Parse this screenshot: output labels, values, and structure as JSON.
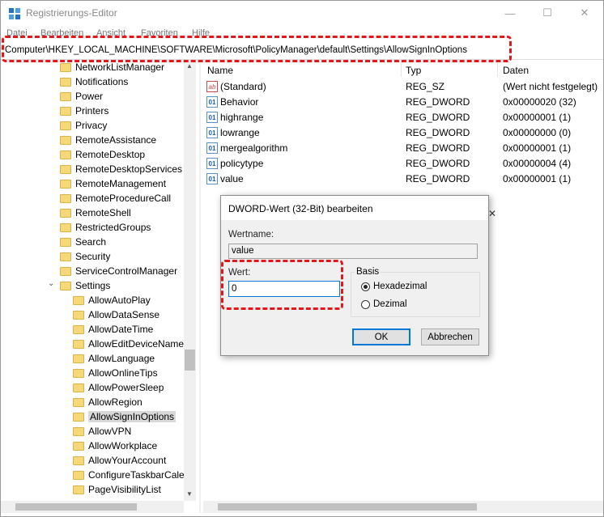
{
  "window": {
    "title": "Registrierungs-Editor"
  },
  "menu": [
    "Datei",
    "Bearbeiten",
    "Ansicht",
    "Favoriten",
    "Hilfe"
  ],
  "address": "Computer\\HKEY_LOCAL_MACHINE\\SOFTWARE\\Microsoft\\PolicyManager\\default\\Settings\\AllowSignInOptions",
  "tree": {
    "items": [
      {
        "label": "NetworkListManager",
        "level": 1
      },
      {
        "label": "Notifications",
        "level": 1
      },
      {
        "label": "Power",
        "level": 1
      },
      {
        "label": "Printers",
        "level": 1
      },
      {
        "label": "Privacy",
        "level": 1
      },
      {
        "label": "RemoteAssistance",
        "level": 1
      },
      {
        "label": "RemoteDesktop",
        "level": 1
      },
      {
        "label": "RemoteDesktopServices",
        "level": 1
      },
      {
        "label": "RemoteManagement",
        "level": 1
      },
      {
        "label": "RemoteProcedureCall",
        "level": 1
      },
      {
        "label": "RemoteShell",
        "level": 1
      },
      {
        "label": "RestrictedGroups",
        "level": 1
      },
      {
        "label": "Search",
        "level": 1
      },
      {
        "label": "Security",
        "level": 1
      },
      {
        "label": "ServiceControlManager",
        "level": 1
      },
      {
        "label": "Settings",
        "level": 1,
        "expanded": true
      },
      {
        "label": "AllowAutoPlay",
        "level": 2
      },
      {
        "label": "AllowDataSense",
        "level": 2
      },
      {
        "label": "AllowDateTime",
        "level": 2
      },
      {
        "label": "AllowEditDeviceName",
        "level": 2
      },
      {
        "label": "AllowLanguage",
        "level": 2
      },
      {
        "label": "AllowOnlineTips",
        "level": 2
      },
      {
        "label": "AllowPowerSleep",
        "level": 2
      },
      {
        "label": "AllowRegion",
        "level": 2
      },
      {
        "label": "AllowSignInOptions",
        "level": 2,
        "selected": true
      },
      {
        "label": "AllowVPN",
        "level": 2
      },
      {
        "label": "AllowWorkplace",
        "level": 2
      },
      {
        "label": "AllowYourAccount",
        "level": 2
      },
      {
        "label": "ConfigureTaskbarCalendar",
        "level": 2
      },
      {
        "label": "PageVisibilityList",
        "level": 2
      }
    ]
  },
  "list": {
    "headers": {
      "name": "Name",
      "type": "Typ",
      "data": "Daten"
    },
    "rows": [
      {
        "icon": "string-value-icon",
        "name": "(Standard)",
        "type": "REG_SZ",
        "data": "(Wert nicht festgelegt)"
      },
      {
        "icon": "dword-value-icon",
        "name": "Behavior",
        "type": "REG_DWORD",
        "data": "0x00000020 (32)"
      },
      {
        "icon": "dword-value-icon",
        "name": "highrange",
        "type": "REG_DWORD",
        "data": "0x00000001 (1)"
      },
      {
        "icon": "dword-value-icon",
        "name": "lowrange",
        "type": "REG_DWORD",
        "data": "0x00000000 (0)"
      },
      {
        "icon": "dword-value-icon",
        "name": "mergealgorithm",
        "type": "REG_DWORD",
        "data": "0x00000001 (1)"
      },
      {
        "icon": "dword-value-icon",
        "name": "policytype",
        "type": "REG_DWORD",
        "data": "0x00000004 (4)"
      },
      {
        "icon": "dword-value-icon",
        "name": "value",
        "type": "REG_DWORD",
        "data": "0x00000001 (1)"
      }
    ]
  },
  "dialog": {
    "title": "DWORD-Wert (32-Bit) bearbeiten",
    "name_label": "Wertname:",
    "name_value": "value",
    "value_label": "Wert:",
    "value": "0",
    "basis_label": "Basis",
    "hex_label": "Hexadezimal",
    "dec_label": "Dezimal",
    "ok": "OK",
    "cancel": "Abbrechen"
  },
  "colors": {
    "highlight": "#e3161c",
    "focus": "#0078d7"
  }
}
